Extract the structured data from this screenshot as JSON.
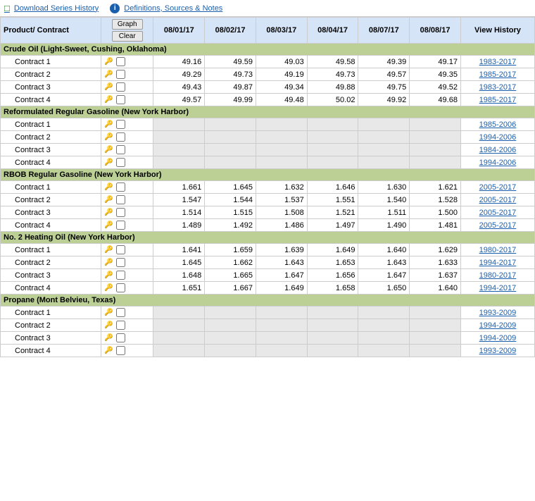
{
  "topbar": {
    "download_label": "Download Series History",
    "definitions_label": "Definitions, Sources & Notes"
  },
  "buttons": {
    "graph": "Graph",
    "clear": "Clear"
  },
  "headers": {
    "product": "Product/ Contract",
    "dates": [
      "08/01/17",
      "08/02/17",
      "08/03/17",
      "08/04/17",
      "08/07/17",
      "08/08/17"
    ],
    "view_history": "View History"
  },
  "categories": [
    {
      "name": "Crude Oil (Light-Sweet, Cushing, Oklahoma)",
      "contracts": [
        {
          "label": "Contract 1",
          "values": [
            "49.16",
            "49.59",
            "49.03",
            "49.58",
            "49.39",
            "49.17"
          ],
          "history": "1983-2017"
        },
        {
          "label": "Contract 2",
          "values": [
            "49.29",
            "49.73",
            "49.19",
            "49.73",
            "49.57",
            "49.35"
          ],
          "history": "1985-2017"
        },
        {
          "label": "Contract 3",
          "values": [
            "49.43",
            "49.87",
            "49.34",
            "49.88",
            "49.75",
            "49.52"
          ],
          "history": "1983-2017"
        },
        {
          "label": "Contract 4",
          "values": [
            "49.57",
            "49.99",
            "49.48",
            "50.02",
            "49.92",
            "49.68"
          ],
          "history": "1985-2017"
        }
      ]
    },
    {
      "name": "Reformulated Regular Gasoline (New York Harbor)",
      "contracts": [
        {
          "label": "Contract 1",
          "values": [
            "",
            "",
            "",
            "",
            "",
            ""
          ],
          "history": "1985-2006"
        },
        {
          "label": "Contract 2",
          "values": [
            "",
            "",
            "",
            "",
            "",
            ""
          ],
          "history": "1994-2006"
        },
        {
          "label": "Contract 3",
          "values": [
            "",
            "",
            "",
            "",
            "",
            ""
          ],
          "history": "1984-2006"
        },
        {
          "label": "Contract 4",
          "values": [
            "",
            "",
            "",
            "",
            "",
            ""
          ],
          "history": "1994-2006"
        }
      ]
    },
    {
      "name": "RBOB Regular Gasoline (New York Harbor)",
      "contracts": [
        {
          "label": "Contract 1",
          "values": [
            "1.661",
            "1.645",
            "1.632",
            "1.646",
            "1.630",
            "1.621"
          ],
          "history": "2005-2017"
        },
        {
          "label": "Contract 2",
          "values": [
            "1.547",
            "1.544",
            "1.537",
            "1.551",
            "1.540",
            "1.528"
          ],
          "history": "2005-2017"
        },
        {
          "label": "Contract 3",
          "values": [
            "1.514",
            "1.515",
            "1.508",
            "1.521",
            "1.511",
            "1.500"
          ],
          "history": "2005-2017"
        },
        {
          "label": "Contract 4",
          "values": [
            "1.489",
            "1.492",
            "1.486",
            "1.497",
            "1.490",
            "1.481"
          ],
          "history": "2005-2017"
        }
      ]
    },
    {
      "name": "No. 2 Heating Oil (New York Harbor)",
      "contracts": [
        {
          "label": "Contract 1",
          "values": [
            "1.641",
            "1.659",
            "1.639",
            "1.649",
            "1.640",
            "1.629"
          ],
          "history": "1980-2017"
        },
        {
          "label": "Contract 2",
          "values": [
            "1.645",
            "1.662",
            "1.643",
            "1.653",
            "1.643",
            "1.633"
          ],
          "history": "1994-2017"
        },
        {
          "label": "Contract 3",
          "values": [
            "1.648",
            "1.665",
            "1.647",
            "1.656",
            "1.647",
            "1.637"
          ],
          "history": "1980-2017"
        },
        {
          "label": "Contract 4",
          "values": [
            "1.651",
            "1.667",
            "1.649",
            "1.658",
            "1.650",
            "1.640"
          ],
          "history": "1994-2017"
        }
      ]
    },
    {
      "name": "Propane (Mont Belvieu, Texas)",
      "contracts": [
        {
          "label": "Contract 1",
          "values": [
            "",
            "",
            "",
            "",
            "",
            ""
          ],
          "history": "1993-2009"
        },
        {
          "label": "Contract 2",
          "values": [
            "",
            "",
            "",
            "",
            "",
            ""
          ],
          "history": "1994-2009"
        },
        {
          "label": "Contract 3",
          "values": [
            "",
            "",
            "",
            "",
            "",
            ""
          ],
          "history": "1994-2009"
        },
        {
          "label": "Contract 4",
          "values": [
            "",
            "",
            "",
            "",
            "",
            ""
          ],
          "history": "1993-2009"
        }
      ]
    }
  ]
}
